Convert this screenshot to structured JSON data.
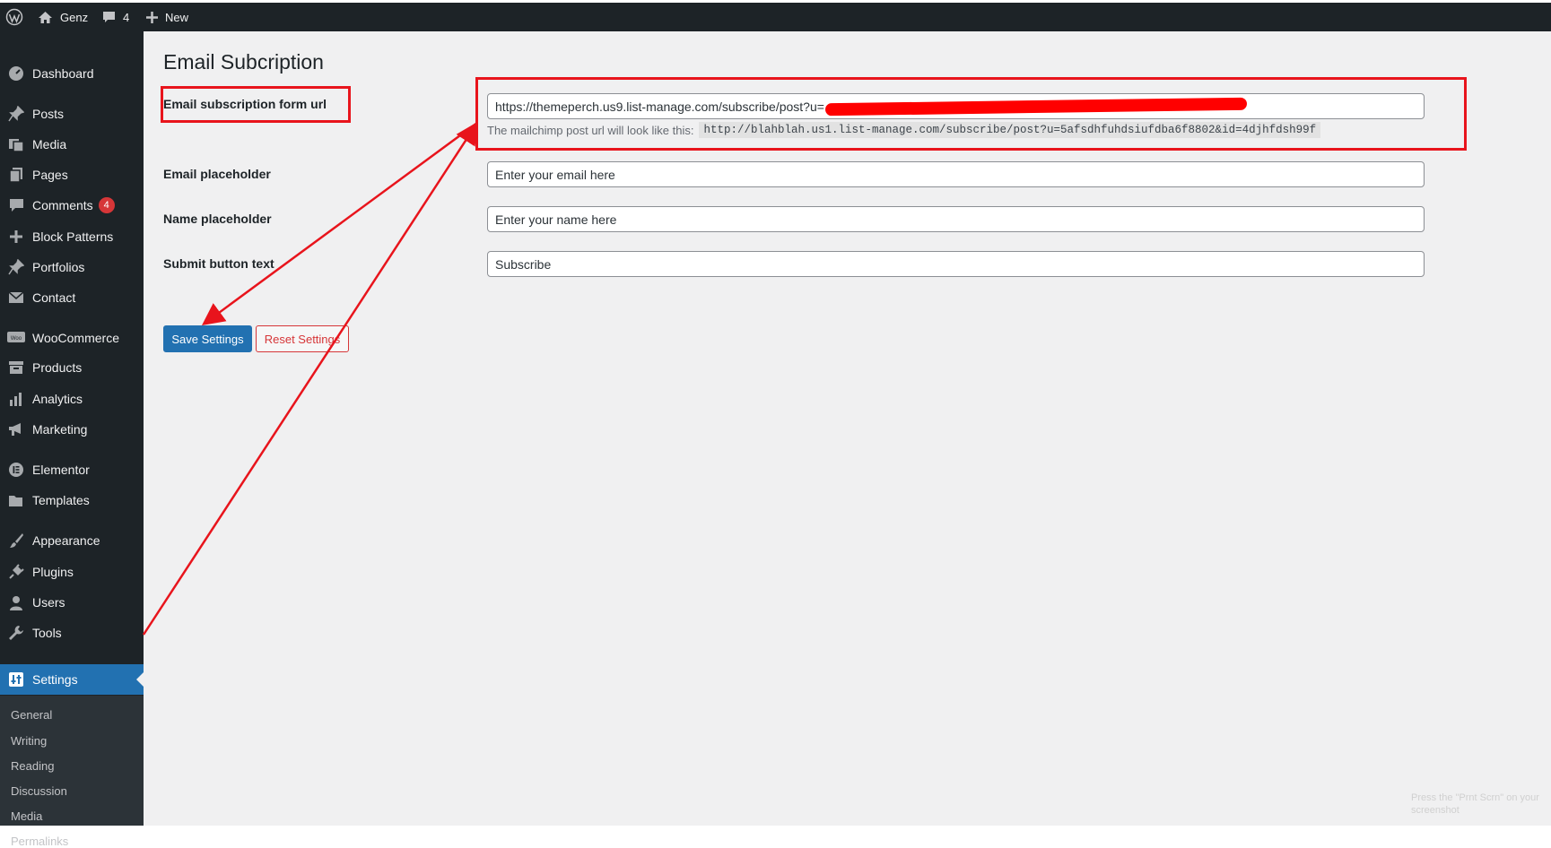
{
  "admin_bar": {
    "site_name": "Genz",
    "comments_count": "4",
    "new_label": "New"
  },
  "sidebar": {
    "items": [
      {
        "label": "Dashboard",
        "icon": "dashboard-icon"
      },
      {
        "label": "Posts",
        "icon": "pin-icon"
      },
      {
        "label": "Media",
        "icon": "media-icon"
      },
      {
        "label": "Pages",
        "icon": "pages-icon"
      },
      {
        "label": "Comments",
        "icon": "comment-icon",
        "badge": "4"
      },
      {
        "label": "Block Patterns",
        "icon": "plus-icon"
      },
      {
        "label": "Portfolios",
        "icon": "pin-icon"
      },
      {
        "label": "Contact",
        "icon": "mail-icon"
      },
      {
        "label": "WooCommerce",
        "icon": "woo-icon"
      },
      {
        "label": "Products",
        "icon": "archive-icon"
      },
      {
        "label": "Analytics",
        "icon": "bar-chart-icon"
      },
      {
        "label": "Marketing",
        "icon": "megaphone-icon"
      },
      {
        "label": "Elementor",
        "icon": "elementor-icon"
      },
      {
        "label": "Templates",
        "icon": "folder-icon"
      },
      {
        "label": "Appearance",
        "icon": "brush-icon"
      },
      {
        "label": "Plugins",
        "icon": "plug-icon"
      },
      {
        "label": "Users",
        "icon": "user-icon"
      },
      {
        "label": "Tools",
        "icon": "wrench-icon"
      },
      {
        "label": "Settings",
        "icon": "settings-icon",
        "active": true
      }
    ],
    "submenu": [
      "General",
      "Writing",
      "Reading",
      "Discussion",
      "Media",
      "Permalinks"
    ]
  },
  "page": {
    "title": "Email Subcription",
    "fields": {
      "form_url": {
        "label": "Email subscription form url",
        "value": "https://themeperch.us9.list-manage.com/subscribe/post?u=",
        "description": "The mailchimp post url will look like this:",
        "example": "http://blahblah.us1.list-manage.com/subscribe/post?u=5afsdhfuhdsiufdba6f8802&id=4djhfdsh99f"
      },
      "email_placeholder": {
        "label": "Email placeholder",
        "value": "Enter your email here"
      },
      "name_placeholder": {
        "label": "Name placeholder",
        "value": "Enter your name here"
      },
      "submit_text": {
        "label": "Submit button text",
        "value": "Subscribe"
      }
    },
    "buttons": {
      "save": "Save Settings",
      "reset": "Reset Settings"
    }
  },
  "colors": {
    "annotation": "#e8141c",
    "admin_bg": "#1d2327",
    "primary": "#2271b1",
    "danger": "#d63638"
  },
  "watermark": "Press the \"Prnt Scrn\" on your screenshot"
}
